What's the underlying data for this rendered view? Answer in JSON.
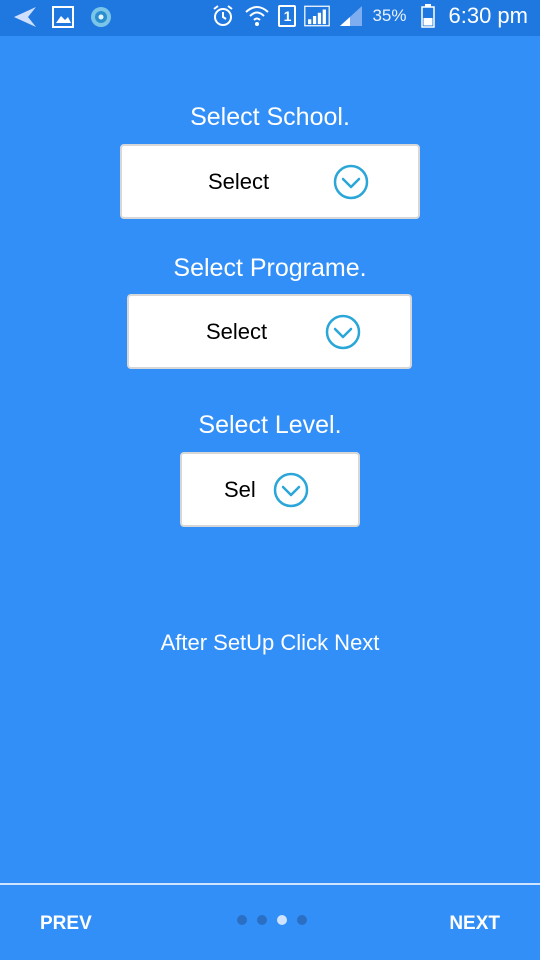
{
  "status_bar": {
    "battery_percent": "35%",
    "time": "6:30 pm",
    "sim_label": "1",
    "left_icons": [
      "navigation-arrow-icon",
      "gallery-icon",
      "app-badge-icon"
    ],
    "right_icons": [
      "alarm-icon",
      "wifi-icon",
      "sim-icon",
      "signal-strong-icon",
      "signal-weak-icon",
      "battery-icon"
    ]
  },
  "form": {
    "school": {
      "label": "Select School.",
      "value": "Select"
    },
    "programme": {
      "label": "Select Programe.",
      "value": "Select"
    },
    "level": {
      "label": "Select Level.",
      "value": "Sel"
    }
  },
  "hint": "After SetUp Click Next",
  "footer": {
    "prev_label": "PREV",
    "next_label": "NEXT",
    "page_count": 4,
    "active_page": 3
  },
  "colors": {
    "background": "#338ff8",
    "status_bar": "#1f78e0",
    "dropdown_icon": "#2aa6d8",
    "text_light": "#ffffff"
  }
}
